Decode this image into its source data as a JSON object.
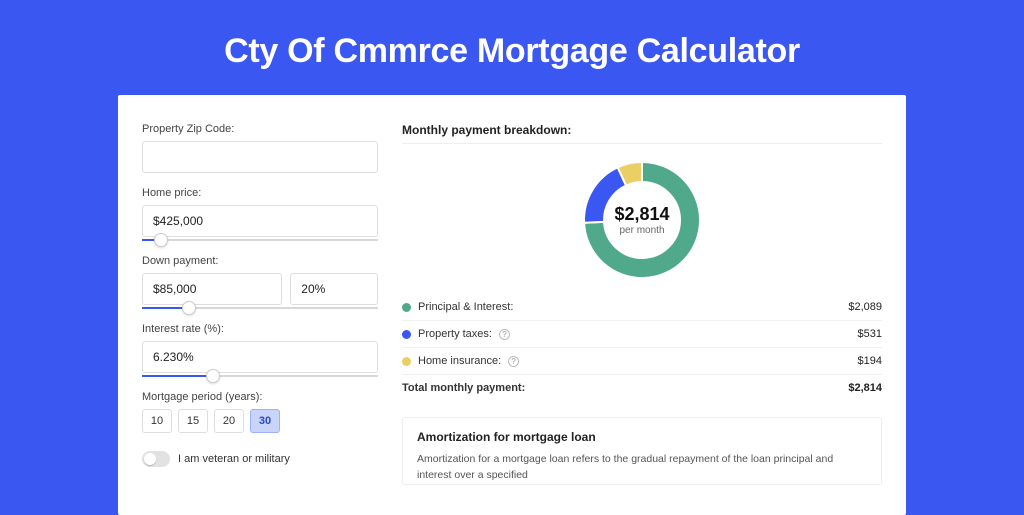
{
  "title": "Cty Of Cmmrce Mortgage Calculator",
  "form": {
    "zip_label": "Property Zip Code:",
    "zip_value": "",
    "home_price_label": "Home price:",
    "home_price_value": "$425,000",
    "down_payment_label": "Down payment:",
    "down_payment_value": "$85,000",
    "down_payment_pct": "20%",
    "interest_label": "Interest rate (%):",
    "interest_value": "6.230%",
    "period_label": "Mortgage period (years):",
    "periods": [
      "10",
      "15",
      "20",
      "30"
    ],
    "period_active": "30",
    "veteran_label": "I am veteran or military"
  },
  "breakdown": {
    "header": "Monthly payment breakdown:",
    "donut_amount": "$2,814",
    "donut_sub": "per month",
    "rows": [
      {
        "label": "Principal & Interest:",
        "value": "$2,089",
        "color": "green",
        "help": false
      },
      {
        "label": "Property taxes:",
        "value": "$531",
        "color": "blue",
        "help": true
      },
      {
        "label": "Home insurance:",
        "value": "$194",
        "color": "yellow",
        "help": true
      }
    ],
    "total_label": "Total monthly payment:",
    "total_value": "$2,814"
  },
  "amort": {
    "title": "Amortization for mortgage loan",
    "text": "Amortization for a mortgage loan refers to the gradual repayment of the loan principal and interest over a specified"
  },
  "chart_data": {
    "type": "pie",
    "title": "Monthly payment breakdown:",
    "series": [
      {
        "name": "Principal & Interest",
        "value": 2089,
        "color": "#51a98b"
      },
      {
        "name": "Property taxes",
        "value": 531,
        "color": "#3a57f2"
      },
      {
        "name": "Home insurance",
        "value": 194,
        "color": "#ead064"
      }
    ],
    "total": 2814,
    "center_label": "$2,814",
    "center_sub": "per month"
  },
  "sliders": {
    "home_price_pct": 8,
    "down_payment_pct": 20,
    "interest_pct": 30
  }
}
